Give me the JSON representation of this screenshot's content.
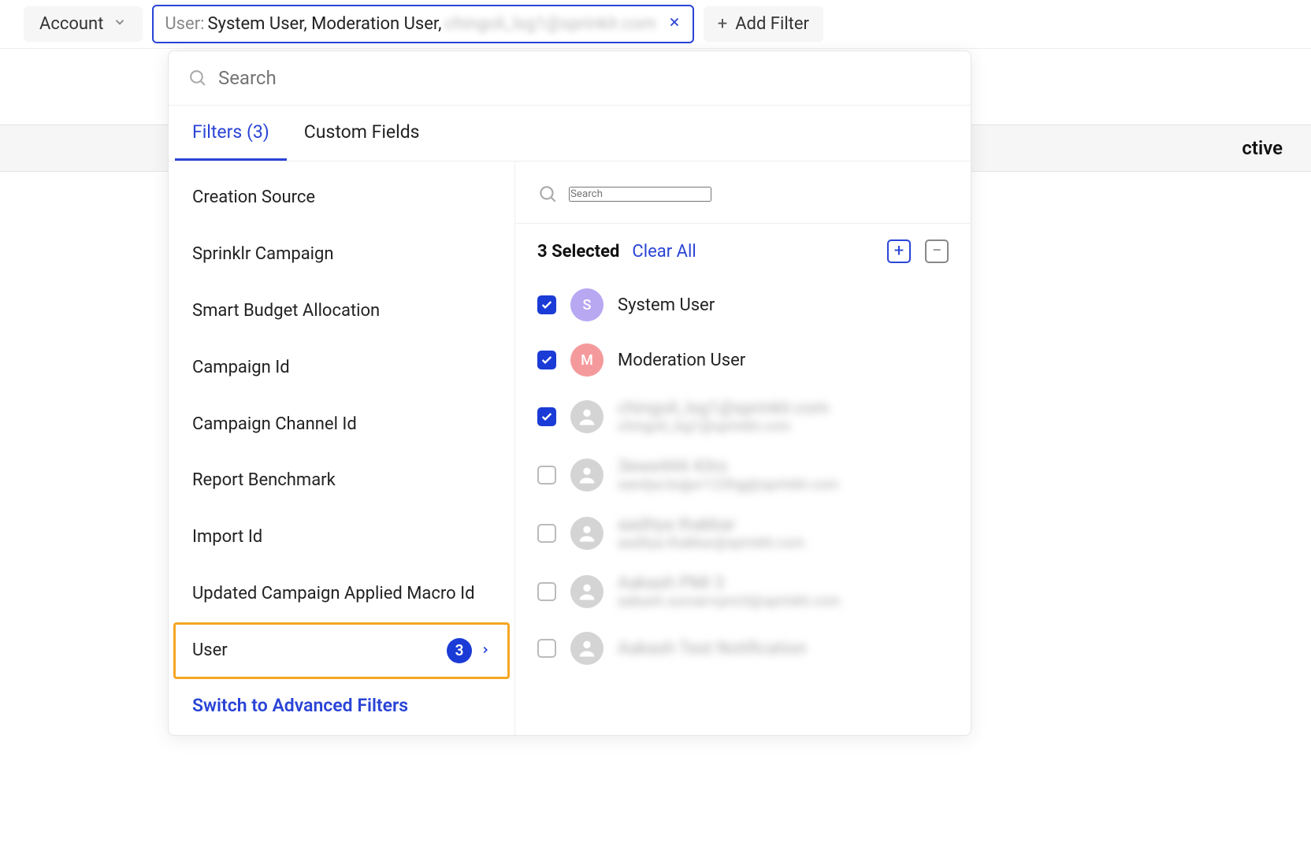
{
  "topbar": {
    "account_label": "Account",
    "user_prefix": "User:",
    "user_value": "System User, Moderation User,",
    "user_blurred": "chingoli_lsg1@sprinklr.com",
    "add_filter_label": "Add Filter"
  },
  "band": {
    "partial_text": "ctive"
  },
  "dropdown": {
    "search_placeholder": "Search",
    "tabs": {
      "filters_label": "Filters (3)",
      "custom_fields_label": "Custom Fields"
    },
    "filter_list": [
      "Creation Source",
      "Sprinklr Campaign",
      "Smart Budget Allocation",
      "Campaign Id",
      "Campaign Channel Id",
      "Report Benchmark",
      "Import Id",
      "Updated Campaign Applied Macro Id"
    ],
    "user_filter": {
      "label": "User",
      "count": "3"
    },
    "switch_label": "Switch to Advanced Filters",
    "right": {
      "search_placeholder": "Search",
      "selected_label": "3 Selected",
      "clear_all_label": "Clear All",
      "users": [
        {
          "name": "System User",
          "sub": "",
          "checked": true,
          "avatar": "S",
          "avatar_class": "s",
          "blurred": false
        },
        {
          "name": "Moderation User",
          "sub": "",
          "checked": true,
          "avatar": "M",
          "avatar_class": "m",
          "blurred": false
        },
        {
          "name": "chingoli_lsg1@sprinklr.com",
          "sub": "chingoli_lsg1@sprinklr.com",
          "checked": true,
          "avatar": "",
          "avatar_class": "gray",
          "blurred": true
        },
        {
          "name": "3ewe444 43ro",
          "sub": "sandya.bojja+123hgj@sprinklr.com",
          "checked": false,
          "avatar": "",
          "avatar_class": "gray",
          "blurred": true
        },
        {
          "name": "aaditya thakkar",
          "sub": "aaditya.thakkar@sprinklr.com",
          "checked": false,
          "avatar": "",
          "avatar_class": "gray",
          "blurred": true
        },
        {
          "name": "Aakash PMI 3",
          "sub": "aakash.suman+pmi3@sprinklr.com",
          "checked": false,
          "avatar": "",
          "avatar_class": "gray",
          "blurred": true
        },
        {
          "name": "Aakash Test Notification",
          "sub": "",
          "checked": false,
          "avatar": "",
          "avatar_class": "gray",
          "blurred": true
        }
      ]
    }
  }
}
